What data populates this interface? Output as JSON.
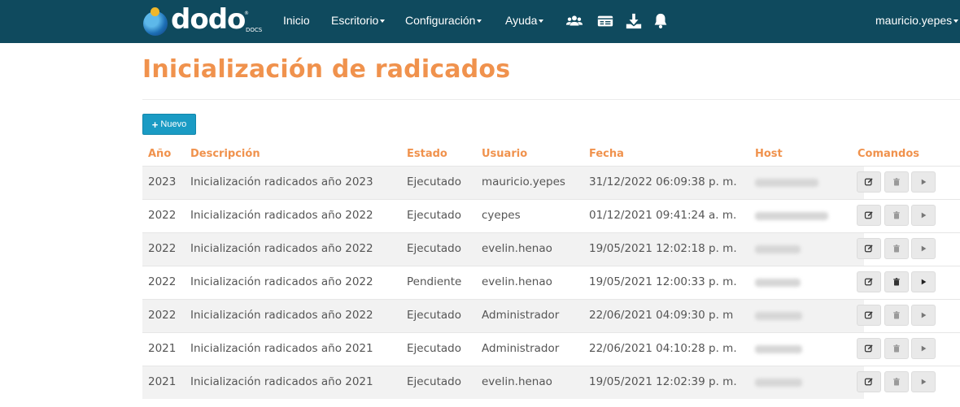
{
  "navbar": {
    "logo_text": "dodo",
    "logo_sub": "DOCS",
    "links": [
      {
        "label": "Inicio"
      },
      {
        "label": "Escritorio"
      },
      {
        "label": "Configuración"
      },
      {
        "label": "Ayuda"
      }
    ],
    "icons": [
      "users-icon",
      "id-card-icon",
      "download-icon",
      "bell-icon"
    ],
    "user": "mauricio.yepes",
    "background_color": "#0f4a5e"
  },
  "page": {
    "title": "Inicialización de radicados",
    "accent_color": "#f0924d",
    "new_button_label": "Nuevo"
  },
  "table": {
    "headers": [
      "Año",
      "Descripción",
      "Estado",
      "Usuario",
      "Fecha",
      "Host",
      "Comandos"
    ],
    "rows": [
      {
        "anio": "2023",
        "descripcion": "Inicialización radicados año 2023",
        "estado": "Ejecutado",
        "usuario": "mauricio.yepes",
        "fecha": "31/12/2022 06:09:38 p. m."
      },
      {
        "anio": "2022",
        "descripcion": "Inicialización radicados año 2022",
        "estado": "Ejecutado",
        "usuario": "cyepes",
        "fecha": "01/12/2021 09:41:24 a. m."
      },
      {
        "anio": "2022",
        "descripcion": "Inicialización radicados año 2022",
        "estado": "Ejecutado",
        "usuario": "evelin.henao",
        "fecha": "19/05/2021 12:02:18 p. m."
      },
      {
        "anio": "2022",
        "descripcion": "Inicialización radicados año 2022",
        "estado": "Pendiente",
        "usuario": "evelin.henao",
        "fecha": "19/05/2021 12:00:33 p. m."
      },
      {
        "anio": "2022",
        "descripcion": "Inicialización radicados año 2022",
        "estado": "Ejecutado",
        "usuario": "Administrador",
        "fecha": "22/06/2021 04:09:30 p. m"
      },
      {
        "anio": "2021",
        "descripcion": "Inicialización radicados año 2021",
        "estado": "Ejecutado",
        "usuario": "Administrador",
        "fecha": "22/06/2021 04:10:28 p. m."
      },
      {
        "anio": "2021",
        "descripcion": "Inicialización radicados año 2021",
        "estado": "Ejecutado",
        "usuario": "evelin.henao",
        "fecha": "19/05/2021 12:02:39 p. m."
      }
    ],
    "commands": [
      "edit-icon",
      "trash-icon",
      "play-icon"
    ]
  }
}
